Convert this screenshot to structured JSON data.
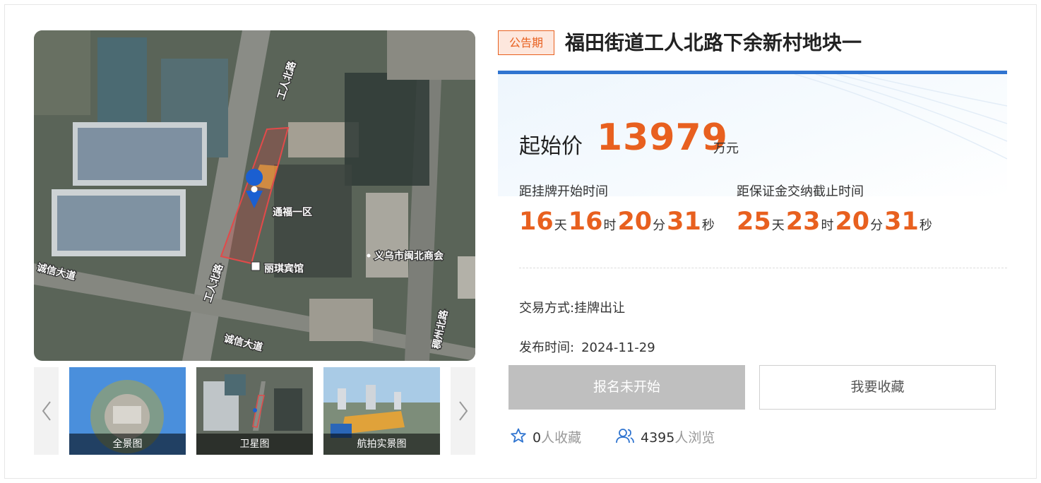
{
  "gallery": {
    "map_labels": {
      "road_gongren_north_1": "工人北路",
      "road_gongren_north_2": "工人北路",
      "road_chengxin_1": "诚信大道",
      "road_chengxin_2": "诚信大道",
      "road_east": "稠州北路",
      "community": "通福一区",
      "hotel": "丽琪宾馆",
      "chamber": "义乌市闽北商会"
    },
    "thumbnails": [
      {
        "label": "全景图"
      },
      {
        "label": "卫星图"
      },
      {
        "label": "航拍实景图"
      }
    ]
  },
  "listing": {
    "status_badge": "公告期",
    "title": "福田街道工人北路下余新村地块一",
    "price_label": "起始价",
    "price_value": "13979",
    "price_unit": "万元",
    "countdown_start": {
      "label": "距挂牌开始时间",
      "days": "16",
      "hours": "16",
      "minutes": "20",
      "seconds": "31"
    },
    "countdown_deposit": {
      "label": "距保证金交纳截止时间",
      "days": "25",
      "hours": "23",
      "minutes": "20",
      "seconds": "31"
    },
    "units": {
      "day": "天",
      "hour": "时",
      "minute": "分",
      "second": "秒"
    },
    "trade_method_label": "交易方式:",
    "trade_method_value": "挂牌出让",
    "publish_label": "发布时间:",
    "publish_value": "2024-11-29",
    "apply_button": "报名未开始",
    "favorite_button": "我要收藏",
    "favorites_count": "0",
    "favorites_suffix": "人收藏",
    "views_count": "4395",
    "views_suffix": "人浏览"
  },
  "colors": {
    "accent_orange": "#e8601f",
    "accent_blue": "#2f74d0",
    "disabled_grey": "#bfbfbf"
  }
}
